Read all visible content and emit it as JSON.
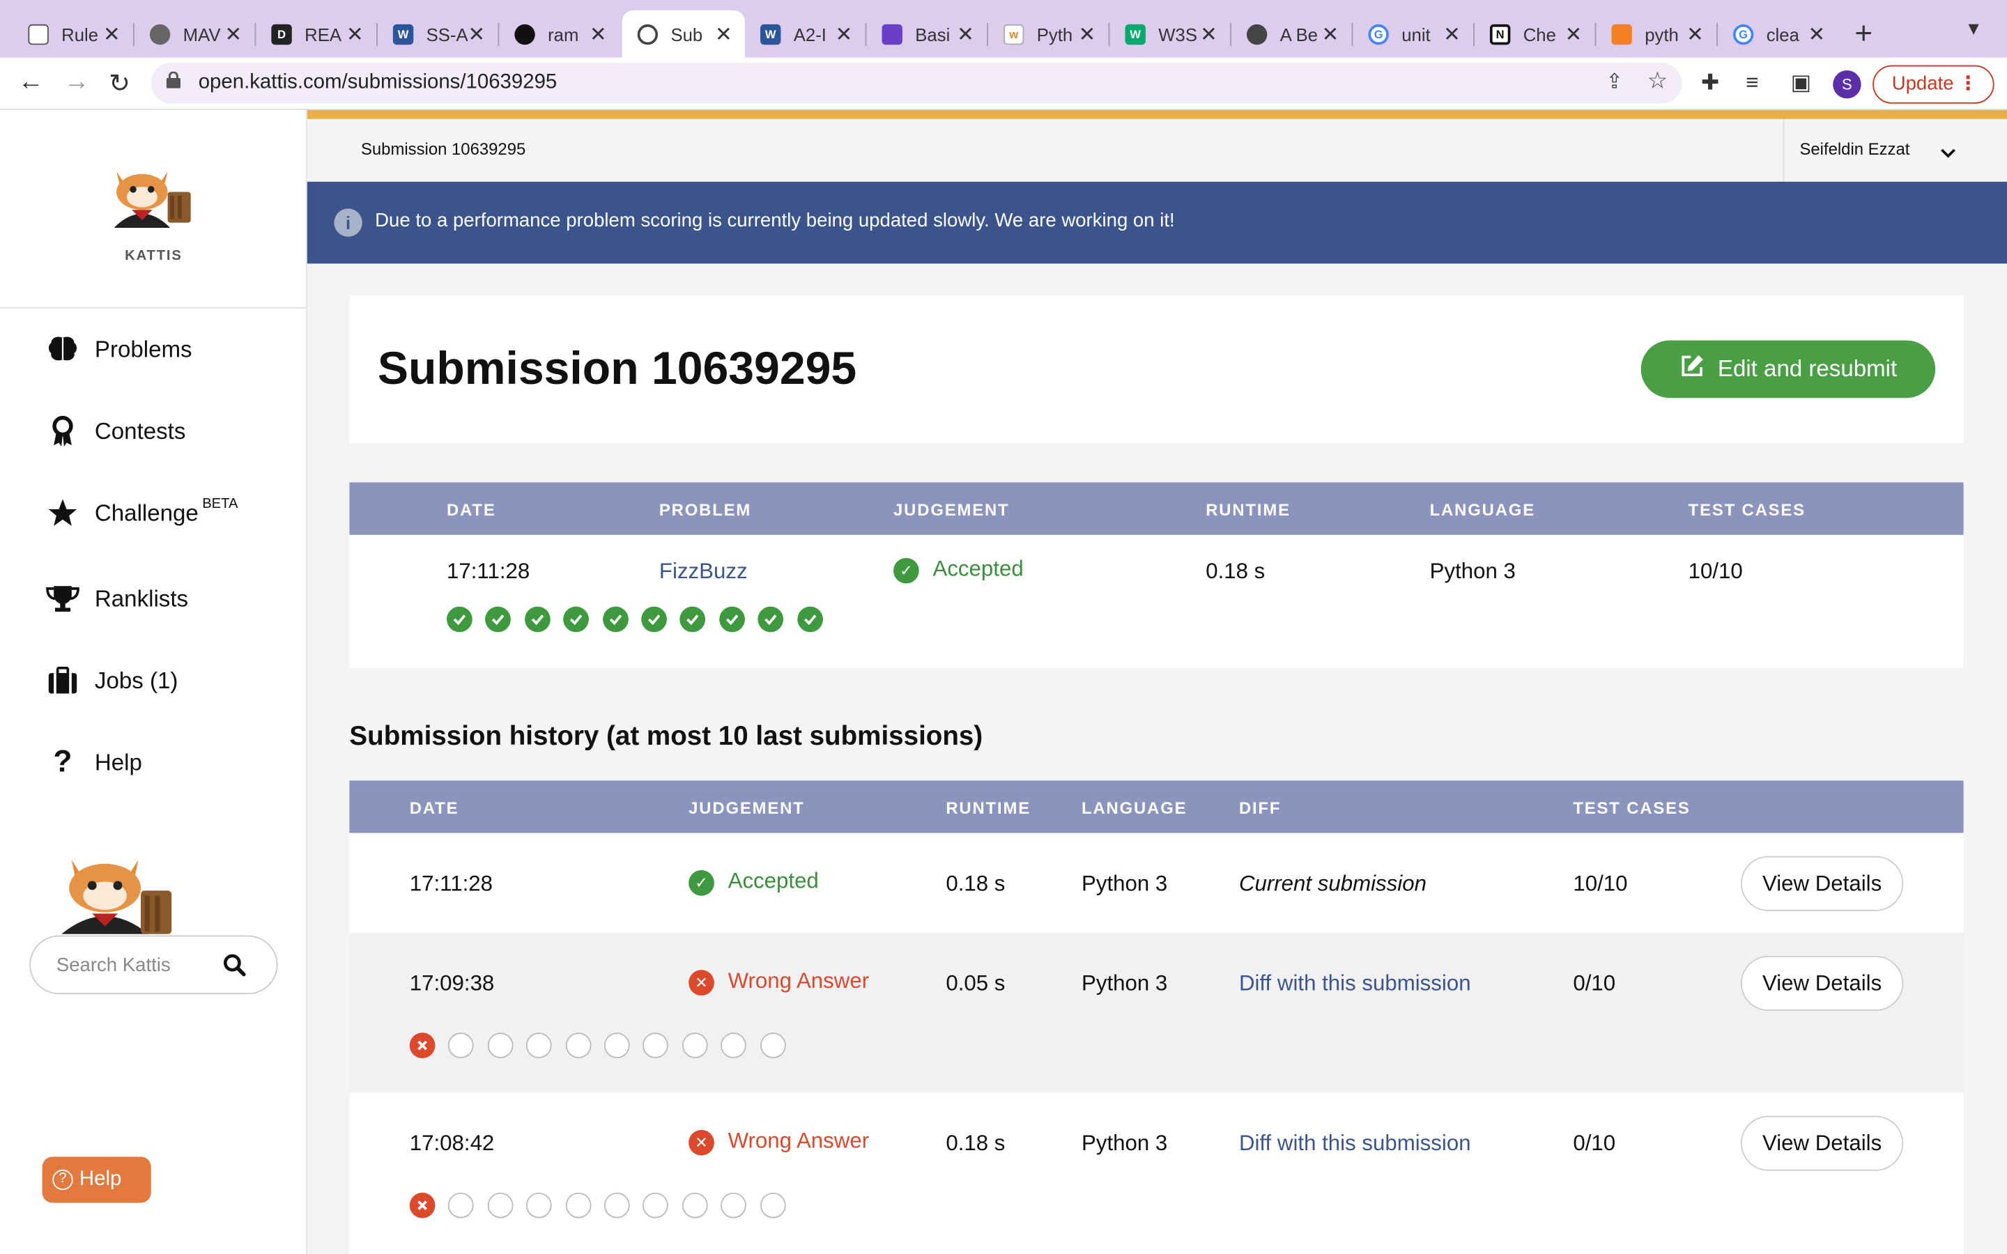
{
  "browser": {
    "tabs": [
      {
        "title": "Rule",
        "icon": "doc-icon"
      },
      {
        "title": "MAV",
        "icon": "globe-icon"
      },
      {
        "title": "REA",
        "icon": "d2l-icon"
      },
      {
        "title": "SS-A",
        "icon": "word-icon"
      },
      {
        "title": "ram",
        "icon": "github-icon"
      },
      {
        "title": "Sub",
        "icon": "kattis-icon"
      },
      {
        "title": "A2-I",
        "icon": "word-icon"
      },
      {
        "title": "Basi",
        "icon": "onenote-icon"
      },
      {
        "title": "Pyth",
        "icon": "w3r-icon"
      },
      {
        "title": "W3S",
        "icon": "w3schools-icon"
      },
      {
        "title": "A Be",
        "icon": "site-icon"
      },
      {
        "title": "unit",
        "icon": "google-icon"
      },
      {
        "title": "Che",
        "icon": "notion-icon"
      },
      {
        "title": "pyth",
        "icon": "stackoverflow-icon"
      },
      {
        "title": "clea",
        "icon": "google-icon"
      }
    ],
    "url": "open.kattis.com/submissions/10639295",
    "profile_initial": "S",
    "update_label": "Update"
  },
  "sidebar": {
    "logo_text": "KATTIS",
    "nav": [
      {
        "label": "Problems",
        "icon": "brain-icon"
      },
      {
        "label": "Contests",
        "icon": "award-icon"
      },
      {
        "label": "Challenge",
        "icon": "star-icon"
      },
      {
        "label": "Ranklists",
        "icon": "trophy-icon"
      },
      {
        "label": "Jobs (1)",
        "icon": "briefcase-icon"
      },
      {
        "label": "Help",
        "icon": "question-icon"
      }
    ],
    "beta_badge": "BETA",
    "search_placeholder": "Search Kattis",
    "help_button": "Help"
  },
  "topbar": {
    "breadcrumb": "Submission 10639295",
    "user_name": "Seifeldin Ezzat"
  },
  "banner": {
    "message": "Due to a performance problem scoring is currently being updated slowly. We are working on it!"
  },
  "submission": {
    "title": "Submission 10639295",
    "resubmit_label": "Edit and resubmit",
    "headers": [
      "DATE",
      "PROBLEM",
      "JUDGEMENT",
      "RUNTIME",
      "LANGUAGE",
      "TEST CASES"
    ],
    "date": "17:11:28",
    "problem": "FizzBuzz",
    "judgement": "Accepted",
    "runtime": "0.18 s",
    "language": "Python 3",
    "test_cases": "10/10",
    "test_results": [
      "pass",
      "pass",
      "pass",
      "pass",
      "pass",
      "pass",
      "pass",
      "pass",
      "pass",
      "pass"
    ]
  },
  "history": {
    "title": "Submission history (at most 10 last submissions)",
    "headers": [
      "DATE",
      "JUDGEMENT",
      "RUNTIME",
      "LANGUAGE",
      "DIFF",
      "TEST CASES"
    ],
    "rows": [
      {
        "date": "17:11:28",
        "judgement": "Accepted",
        "status": "accepted",
        "runtime": "0.18 s",
        "language": "Python 3",
        "diff": "Current submission",
        "test_cases": "10/10",
        "action": "View Details"
      },
      {
        "date": "17:09:38",
        "judgement": "Wrong Answer",
        "status": "wrong",
        "runtime": "0.05 s",
        "language": "Python 3",
        "diff": "Diff with this submission",
        "test_cases": "0/10",
        "action": "View Details"
      },
      {
        "date": "17:08:42",
        "judgement": "Wrong Answer",
        "status": "wrong",
        "runtime": "0.18 s",
        "language": "Python 3",
        "diff": "Diff with this submission",
        "test_cases": "0/10",
        "action": "View Details"
      }
    ]
  },
  "colors": {
    "accent_green": "#4a9f45",
    "header_blue": "#8a94bd",
    "banner_blue": "#3b558c",
    "wrong_red": "#d84a2e",
    "top_stripe": "#e7b04a"
  }
}
